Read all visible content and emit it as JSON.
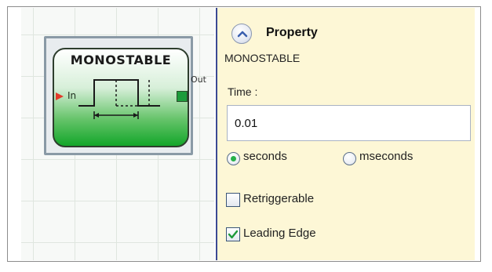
{
  "colors": {
    "accent_green": "#13a62a",
    "input_arrow": "#e23a2a",
    "panel_background": "#fdf7d6",
    "canvas_divider": "#3b4a93"
  },
  "canvas": {
    "block": {
      "title": "MONOSTABLE",
      "input_label": "In",
      "output_label": "Out",
      "icon": "monostable-pulse-icon"
    }
  },
  "panel": {
    "collapse_icon": "chevron-up-icon",
    "title": "Property",
    "block_name": "MONOSTABLE",
    "time": {
      "label": "Time :",
      "value": "0.01"
    },
    "units": [
      {
        "label": "seconds",
        "selected": true
      },
      {
        "label": "mseconds",
        "selected": false
      }
    ],
    "options": [
      {
        "label": "Retriggerable",
        "checked": false
      },
      {
        "label": "Leading Edge",
        "checked": true
      }
    ]
  }
}
